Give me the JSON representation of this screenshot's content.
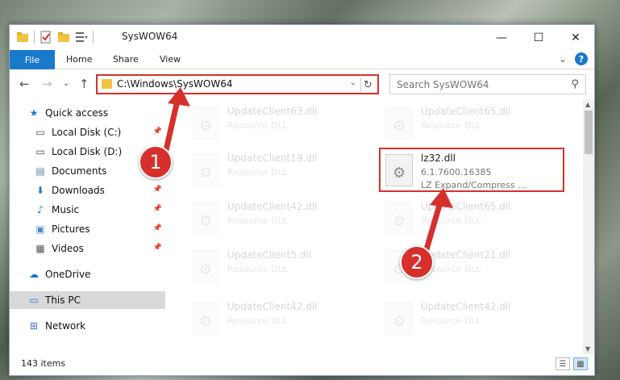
{
  "window": {
    "title": "SysWOW64",
    "min_glyph": "—",
    "max_glyph": "☐",
    "close_glyph": "✕"
  },
  "ribbon": {
    "file": "File",
    "home": "Home",
    "share": "Share",
    "view": "View",
    "expand_glyph": "⌄",
    "help_glyph": "?"
  },
  "address": {
    "path": "C:\\Windows\\SysWOW64",
    "drop_glyph": "⌄",
    "refresh_glyph": "↻"
  },
  "nav_buttons": {
    "back": "←",
    "forward": "→",
    "recent": "⌄",
    "up": "↑"
  },
  "search": {
    "placeholder": "Search SysWOW64",
    "icon_glyph": "⚲"
  },
  "navpane": {
    "items": [
      {
        "label": "Quick access",
        "icon": "star-icon",
        "glyph": "★"
      },
      {
        "label": "Local Disk (C:)",
        "icon": "drive-icon",
        "glyph": "▭",
        "pin": "📌"
      },
      {
        "label": "Local Disk (D:)",
        "icon": "drive-icon",
        "glyph": "▭"
      },
      {
        "label": "Documents",
        "icon": "document-icon",
        "glyph": "▤",
        "pin": "📌"
      },
      {
        "label": "Downloads",
        "icon": "download-icon",
        "glyph": "⬇",
        "pin": "📌"
      },
      {
        "label": "Music",
        "icon": "music-icon",
        "glyph": "♪",
        "pin": "📌"
      },
      {
        "label": "Pictures",
        "icon": "pictures-icon",
        "glyph": "▣",
        "pin": "📌"
      },
      {
        "label": "Videos",
        "icon": "video-icon",
        "glyph": "▦",
        "pin": "📌"
      },
      {
        "label": "OneDrive",
        "icon": "cloud-icon",
        "glyph": "☁"
      },
      {
        "label": "This PC",
        "icon": "computer-icon",
        "glyph": "▭"
      },
      {
        "label": "Network",
        "icon": "network-icon",
        "glyph": "⊞"
      }
    ]
  },
  "files": [
    {
      "name": "UpdateClient63.dll",
      "desc": "Resource DLL"
    },
    {
      "name": "UpdateClient65.dll",
      "desc": "Resource DLL"
    },
    {
      "name": "UpdateClient19.dll",
      "desc": "Resource DLL"
    },
    {
      "name": "lz32.dll",
      "desc": "6.1.7600.16385",
      "desc2": "LZ Expand/Compress ..."
    },
    {
      "name": "UpdateClient42.dll",
      "desc": "Resource DLL"
    },
    {
      "name": "UpdateClient65.dll",
      "desc": "Resource DLL"
    },
    {
      "name": "UpdateClient5.dll",
      "desc": "Resource DLL"
    },
    {
      "name": "UpdateClient21.dll",
      "desc": "Resource DLL"
    },
    {
      "name": "UpdateClient42.dll",
      "desc": "Resource DLL"
    },
    {
      "name": "UpdateClient42.dll",
      "desc": "Resource DLL"
    }
  ],
  "file_icon_glyph": "⚙",
  "status": {
    "count": "143 items"
  },
  "annotations": {
    "badge1": "1",
    "badge2": "2",
    "color": "#d6302c"
  },
  "colors": {
    "accent": "#1979ca",
    "highlight": "#d6302c",
    "folder": "#f1c240"
  }
}
